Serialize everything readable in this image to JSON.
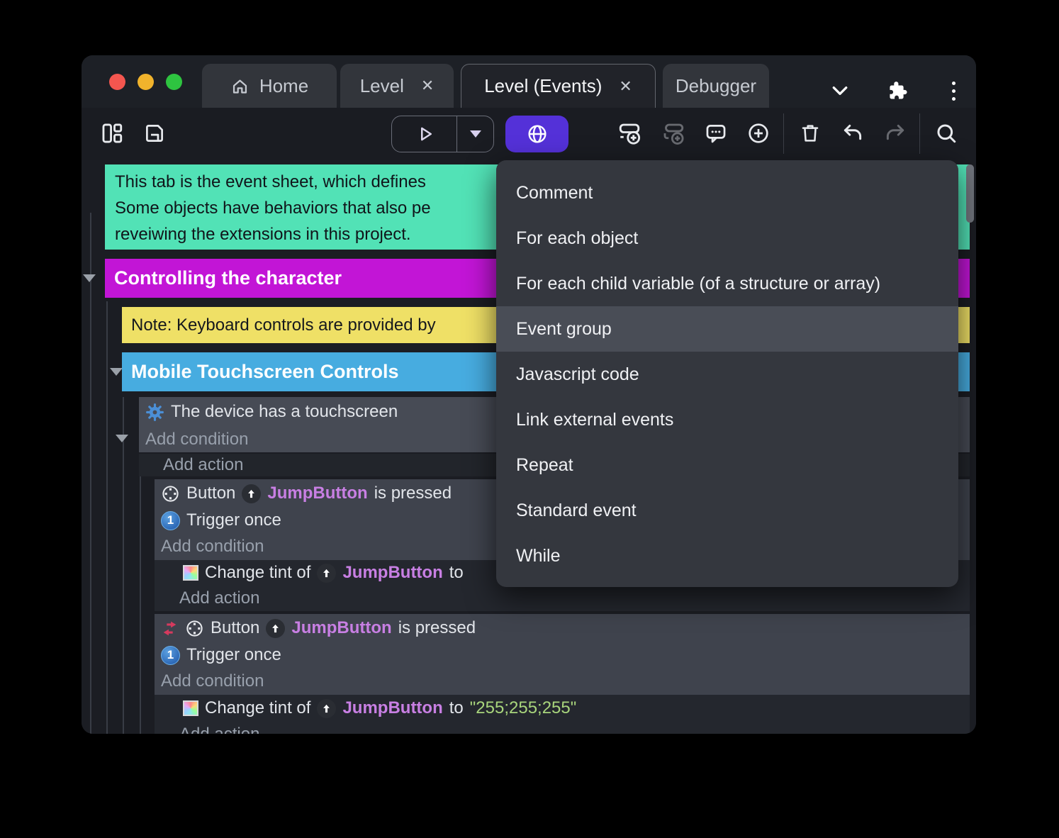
{
  "titlebar": {
    "tabs": {
      "home": "Home",
      "level": "Level",
      "events": "Level (Events)",
      "debugger": "Debugger"
    },
    "close_glyph": "✕",
    "traffic_lights": {
      "close": "#f4564f",
      "minimize": "#f1b32c",
      "zoom": "#2ec440"
    }
  },
  "toolbar": {
    "buttons": [
      "layout-panels",
      "save",
      "play",
      "play-options",
      "preview-remote-globe",
      "add-event",
      "add-sub-event",
      "add-comment",
      "add-circle",
      "delete",
      "undo",
      "redo",
      "search"
    ],
    "accent_color": "#5431d8"
  },
  "sheet": {
    "comment_line1": "This tab is the event sheet, which defines",
    "comment_line2": "Some objects have behaviors that also pe",
    "comment_line3": "reveiwing the extensions in this project.",
    "group_controlling": "Controlling the character",
    "note_keyboard": "Note: Keyboard controls are provided by",
    "group_mobile": "Mobile Touchscreen Controls",
    "labels": {
      "add_condition": "Add condition",
      "add_action": "Add action",
      "trigger_once": "Trigger once"
    },
    "event_touchscreen": {
      "condition": "The device has a touchscreen"
    },
    "event_jump1": {
      "object": "Button",
      "instance": "JumpButton",
      "predicate": "is pressed",
      "action_prefix": "Change tint of",
      "action_to": "to"
    },
    "event_jump2": {
      "object": "Button",
      "instance": "JumpButton",
      "predicate": "is pressed",
      "action_prefix": "Change tint of",
      "action_to": "to",
      "action_value": "\"255;255;255\""
    },
    "colors": {
      "comment_teal": "#52e2b6",
      "group_magenta": "#c215d6",
      "note_yellow": "#efe066",
      "group_blue": "#47ace0",
      "object_purple": "#c87fe3",
      "string_green": "#a8d57c"
    }
  },
  "context_menu": {
    "items": [
      "Comment",
      "For each object",
      "For each child variable (of a structure or array)",
      "Event group",
      "Javascript code",
      "Link external events",
      "Repeat",
      "Standard event",
      "While"
    ],
    "highlighted": "Event group"
  }
}
